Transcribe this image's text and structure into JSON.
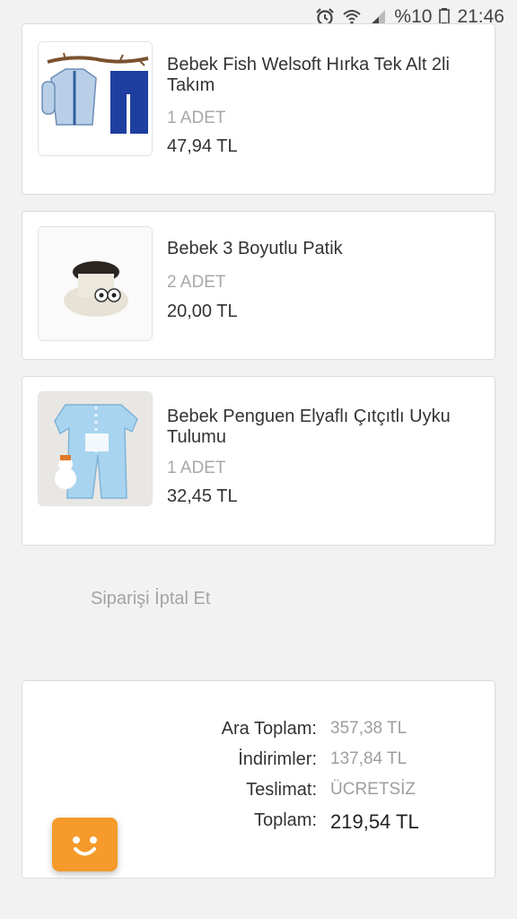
{
  "status_bar": {
    "battery_percent": "%10",
    "time": "21:46",
    "icons": [
      "alarm-icon",
      "wifi-icon",
      "signal-icon",
      "battery-icon"
    ]
  },
  "items": [
    {
      "name": "Bebek Fish Welsoft Hırka Tek Alt 2li Takım",
      "quantity": "1 ADET",
      "price": "47,94 TL",
      "image": "baby-cardigan-set"
    },
    {
      "name": "Bebek 3 Boyutlu Patik",
      "quantity": "2 ADET",
      "price": "20,00 TL",
      "image": "baby-bootie"
    },
    {
      "name": "Bebek Penguen Elyaflı Çıtçıtlı Uyku Tulumu",
      "quantity": "1 ADET",
      "price": "32,45 TL",
      "image": "baby-sleepsuit"
    }
  ],
  "cancel_order_label": "Siparişi İptal Et",
  "summary": {
    "subtotal_label": "Ara Toplam:",
    "subtotal_value": "357,38 TL",
    "discounts_label": "İndirimler:",
    "discounts_value": "137,84 TL",
    "delivery_label": "Teslimat:",
    "delivery_value": "ÜCRETSİZ",
    "total_label": "Toplam:",
    "total_value": "219,54 TL"
  },
  "colors": {
    "accent_orange": "#f59a2b",
    "background": "#f2f2f2",
    "card": "#ffffff",
    "muted_text": "#a8a8a8"
  }
}
